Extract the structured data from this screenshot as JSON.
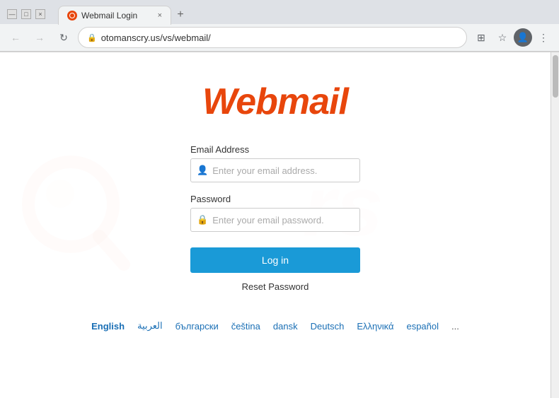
{
  "browser": {
    "tab_title": "Webmail Login",
    "new_tab_symbol": "+",
    "close_symbol": "×",
    "address": "otomanscry.us/vs/webmail/",
    "nav": {
      "back": "←",
      "forward": "→",
      "reload": "↻",
      "lock": "🔒"
    }
  },
  "page": {
    "logo": "Webmail",
    "form": {
      "email_label": "Email Address",
      "email_placeholder": "Enter your email address.",
      "password_label": "Password",
      "password_placeholder": "Enter your email password.",
      "login_button": "Log in",
      "reset_link": "Reset Password"
    },
    "languages": [
      {
        "code": "en",
        "label": "English",
        "active": true
      },
      {
        "code": "ar",
        "label": "العربية",
        "active": false
      },
      {
        "code": "bg",
        "label": "български",
        "active": false
      },
      {
        "code": "cs",
        "label": "čeština",
        "active": false
      },
      {
        "code": "da",
        "label": "dansk",
        "active": false
      },
      {
        "code": "de",
        "label": "Deutsch",
        "active": false
      },
      {
        "code": "el",
        "label": "Ελληνικά",
        "active": false
      },
      {
        "code": "es",
        "label": "español",
        "active": false
      }
    ],
    "more_languages": "..."
  }
}
